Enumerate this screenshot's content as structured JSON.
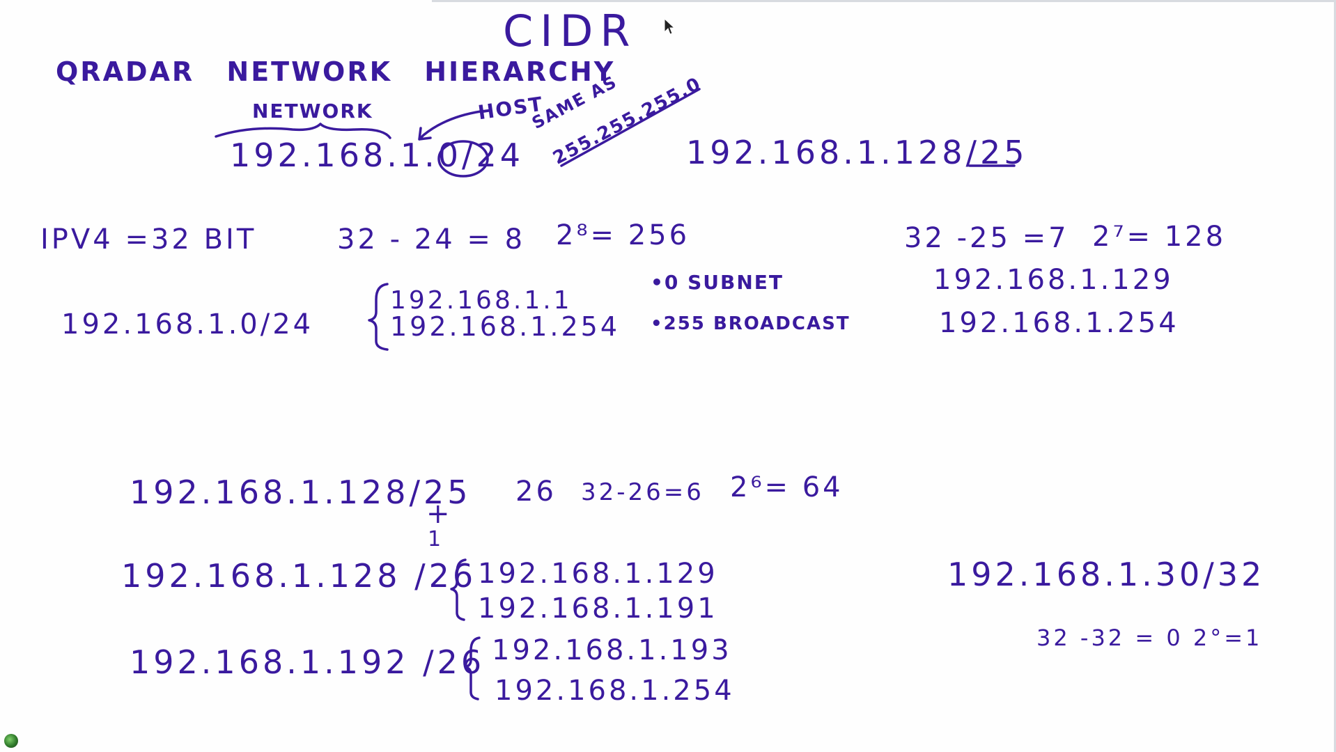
{
  "board": {
    "title": "CIDR",
    "subtitle": "QRADAR  NETWORK  HIERARCHY",
    "network_label": "NETWORK",
    "host_label": "HOST",
    "same_as_line1": "SAME AS",
    "same_as_line2": "255.255.255.0",
    "example_cidr_24": "192.168.1.0/24",
    "example_cidr_25": "192.168.1.128/25",
    "ipv4_bits": "IPV4 =32 BIT",
    "calc_24": "32 - 24 = 8",
    "pow_8": "2⁸= 256",
    "calc_25": "32 -25 =7",
    "pow_7": "2⁷= 128",
    "range_25_start": "192.168.1.129",
    "range_25_end": "192.168.1.254",
    "net_24": "192.168.1.0/24",
    "range_24_start": "192.168.1.1",
    "range_24_end": "192.168.1.254",
    "subnet_note": "•0 SUBNET",
    "broadcast_note": "•255 BROADCAST",
    "split_cidr": "192.168.1.128/25",
    "plus": "+",
    "one": "1",
    "new_prefix": "26",
    "calc_26": "32-26=6",
    "pow_6": "2⁶= 64",
    "sub_a": "192.168.1.128 /26",
    "sub_a_start": "192.168.1.129",
    "sub_a_end": "192.168.1.191",
    "sub_b": "192.168.1.192 /26",
    "sub_b_start": "192.168.1.193",
    "sub_b_end": "192.168.1.254",
    "host_32": "192.168.1.30/32",
    "calc_32": "32 -32 = 0  2°=1"
  },
  "colors": {
    "ink": "#3a1a9e",
    "background": "#fefefe"
  },
  "icons": {
    "cursor": "arrow-cursor-icon",
    "corner": "app-globe-icon"
  }
}
